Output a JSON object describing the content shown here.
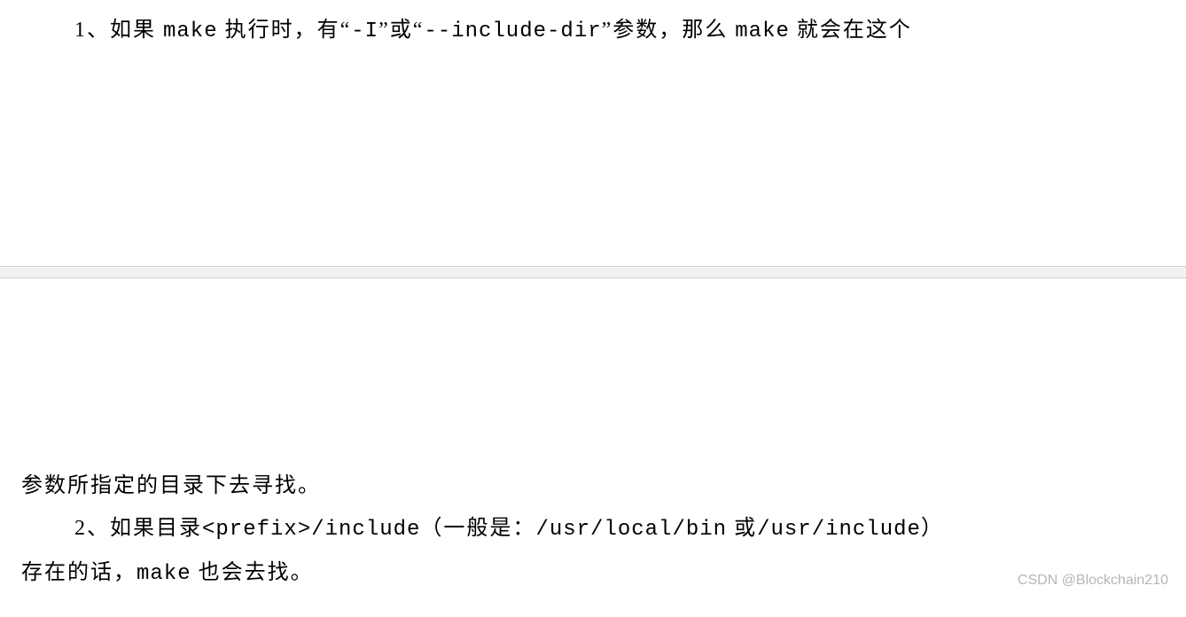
{
  "top": {
    "line1_pre": "1、如果 ",
    "line1_make1": "make",
    "line1_mid1": " 执行时，有“",
    "line1_flag1": "-I",
    "line1_mid2": "”或“",
    "line1_flag2": "--include-dir",
    "line1_mid3": "”参数，那么 ",
    "line1_make2": "make",
    "line1_tail": " 就会在这个"
  },
  "bottom": {
    "cont": "参数所指定的目录下去寻找。",
    "line2_pre": "2、如果目录",
    "line2_prefix": "<prefix>/include",
    "line2_mid1": "（一般是：",
    "line2_path1": "/usr/local/bin",
    "line2_or": " 或",
    "line2_path2": "/usr/include",
    "line2_mid2": "）",
    "line3_pre": "存在的话，",
    "line3_make": "make",
    "line3_tail": " 也会去找。"
  },
  "watermark": "CSDN @Blockchain210"
}
